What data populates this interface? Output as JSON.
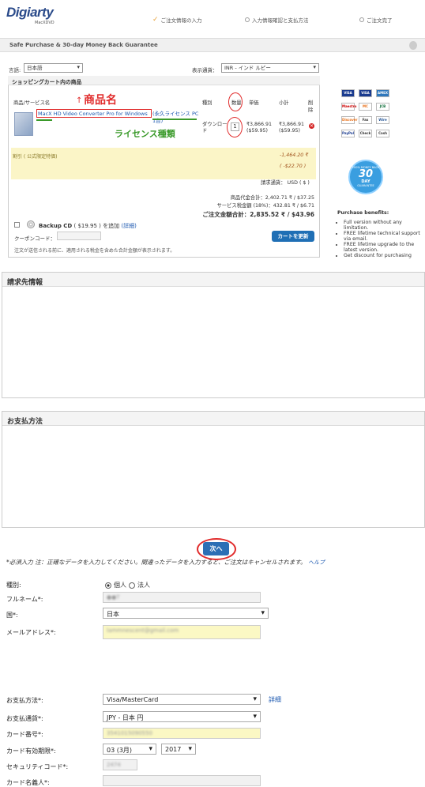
{
  "header": {
    "logo": "Digiarty",
    "logo_sub": "MacXDVD",
    "steps": [
      "ご注文情報の入力",
      "入力情報確認と支払方法",
      "ご注文完了"
    ]
  },
  "secure_bar": "Safe Purchase & 30-day Money Back Guarantee",
  "language": {
    "label": "言語:",
    "value": "日本語"
  },
  "currency": {
    "label": "表示通貨：",
    "value": "INR - インド ルピー"
  },
  "cart": {
    "title": "ショッピングカート内の商品",
    "columns": [
      "商品/サービス名",
      "種別",
      "数量",
      "単価",
      "小計",
      "削除"
    ],
    "item": {
      "name": "MacX HD Video Converter Pro for Windows",
      "license": "(永久ライセンス PC 1台)",
      "type": "ダウンロード",
      "qty": "1",
      "unit_price": "₹3,866.91 ($59.95)",
      "subtotal": "₹3,866.91 ($59.95)"
    },
    "annotation_name": "商品名",
    "annotation_license": "ライセンス種類",
    "discount": {
      "label": "割引 ( 公式限定特価)",
      "value": "-1,464.20 ₹",
      "value_usd": "( -$22.70 )"
    },
    "billing_currency": "請求通貨： USD ( $ )",
    "totals": [
      {
        "label": "商品代金合計：",
        "value": "2,402.71 ₹ / $37.25"
      },
      {
        "label": "サービス税金額 (18%)：",
        "value": "432.81 ₹ / $6.71"
      },
      {
        "label": "ご注文金額合計：",
        "value": "2,835.52 ₹ / $43.96"
      }
    ],
    "backup_cd": {
      "title": "Backup CD",
      "text": "( $19.95 ) を追加",
      "link": "(詳細)"
    },
    "coupon_label": "クーポンコード：",
    "update_button": "カートを更新",
    "note": "注文が送信される前に、適用される税金を含めた合計金額が表示されます。"
  },
  "payment_cards": [
    "VISA",
    "VISA Electron",
    "AMEX",
    "Maestro",
    "MC",
    "JCB",
    "Discover",
    "Fax",
    "Wire",
    "PayPal",
    "Check",
    "Cash"
  ],
  "badge": {
    "line1": "100% MONEY BACK",
    "big": "30",
    "line2": "DAY",
    "line3": "GUARANTEE"
  },
  "benefits": {
    "title": "Purchase benefits:",
    "items": [
      "Full version without any limitation.",
      "FREE lifetime technical support via email.",
      "FREE lifetime upgrade to the latest version.",
      "Get discount for purchasing"
    ]
  },
  "billing": {
    "title": "請求先情報",
    "notice": "*必須入力 注：正確なデータを入力してください。間違ったデータを入力すると、ご注文はキャンセルされます。",
    "help": "ヘルプ",
    "type_label": "種別:",
    "type_options": [
      "個人",
      "法人"
    ],
    "fullname_label": "フルネーム*:",
    "fullname_value": "●●T",
    "country_label": "国*:",
    "country_value": "日本",
    "email_label": "メールアドレス*:",
    "email_value": "lammnescent@gmail.com"
  },
  "payment": {
    "title": "お支払方法",
    "method_label": "お支払方法*:",
    "method_value": "Visa/MasterCard",
    "detail_link": "詳細",
    "currency_label": "お支払通貨*:",
    "currency_value": "JPY - 日本 円",
    "card_label": "カード番号*:",
    "card_value": "3541015090550",
    "expiry_label": "カード有効期限*:",
    "expiry_month": "03 (3月)",
    "expiry_year": "2017",
    "cvv_label": "セキュリティコード*:",
    "cvv_value": "2474",
    "holder_label": "カード名義人*:",
    "holder_value": ""
  },
  "next_button": "次へ"
}
